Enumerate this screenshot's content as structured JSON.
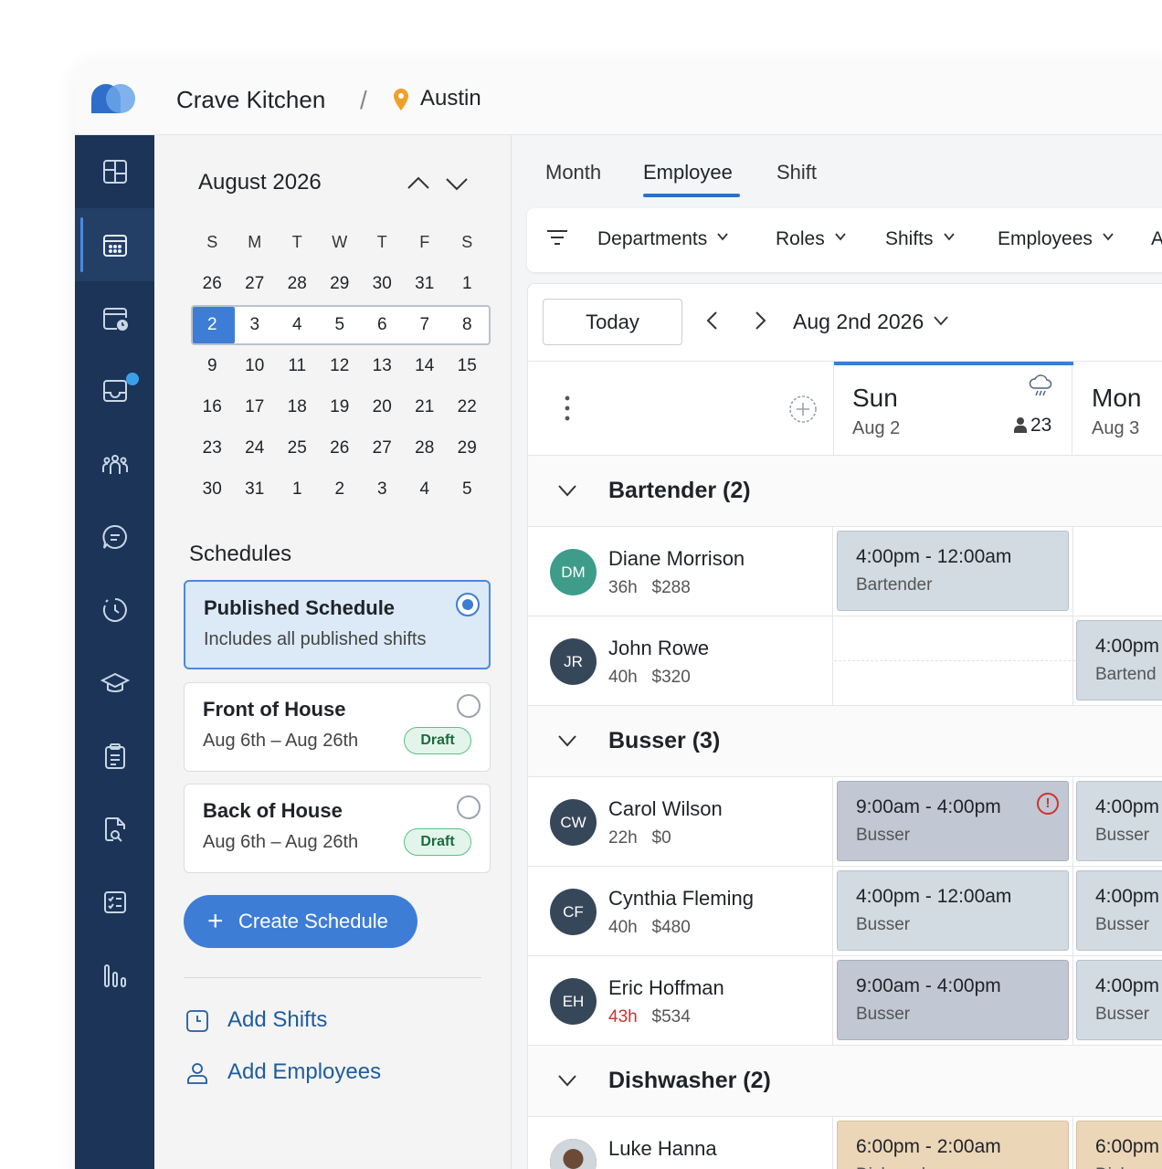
{
  "header": {
    "company": "Crave Kitchen",
    "separator": "/",
    "location": "Austin",
    "brand_color": "#2f6fc9"
  },
  "rail": {
    "items": [
      {
        "name": "dashboard-icon"
      },
      {
        "name": "schedule-calendar-icon",
        "active": true
      },
      {
        "name": "time-off-calendar-icon"
      },
      {
        "name": "inbox-icon",
        "notification": true
      },
      {
        "name": "team-icon"
      },
      {
        "name": "chat-icon"
      },
      {
        "name": "timeclock-icon"
      },
      {
        "name": "training-cap-icon"
      },
      {
        "name": "clipboard-icon"
      },
      {
        "name": "document-search-icon"
      },
      {
        "name": "checklist-icon"
      },
      {
        "name": "reports-bars-icon"
      }
    ]
  },
  "calendar": {
    "title": "August 2026",
    "weekdays": [
      "S",
      "M",
      "T",
      "W",
      "T",
      "F",
      "S"
    ],
    "weeks": [
      [
        "26",
        "27",
        "28",
        "29",
        "30",
        "31",
        "1"
      ],
      [
        "2",
        "3",
        "4",
        "5",
        "6",
        "7",
        "8"
      ],
      [
        "9",
        "10",
        "11",
        "12",
        "13",
        "14",
        "15"
      ],
      [
        "16",
        "17",
        "18",
        "19",
        "20",
        "21",
        "22"
      ],
      [
        "23",
        "24",
        "25",
        "26",
        "27",
        "28",
        "29"
      ],
      [
        "30",
        "31",
        "1",
        "2",
        "3",
        "4",
        "5"
      ]
    ],
    "selected_day": "2"
  },
  "schedules": {
    "title": "Schedules",
    "items": [
      {
        "title": "Published Schedule",
        "subtitle": "Includes all published shifts",
        "selected": true
      },
      {
        "title": "Front of House",
        "subtitle": "Aug 6th – Aug 26th",
        "badge": "Draft"
      },
      {
        "title": "Back of House",
        "subtitle": "Aug 6th – Aug 26th",
        "badge": "Draft"
      }
    ],
    "create_label": "Create Schedule",
    "create_icon": "+",
    "add_shifts": "Add Shifts",
    "add_employees": "Add Employees"
  },
  "tabs": [
    {
      "label": "Month"
    },
    {
      "label": "Employee",
      "active": true
    },
    {
      "label": "Shift"
    }
  ],
  "filters": [
    "Departments",
    "Roles",
    "Shifts",
    "Employees",
    "A"
  ],
  "toolbar": {
    "today": "Today",
    "date": "Aug 2nd 2026"
  },
  "days": [
    {
      "name": "Sun",
      "date": "Aug 2",
      "weather": "rain-cloud-icon",
      "count": "23",
      "active": true
    },
    {
      "name": "Mon",
      "date": "Aug 3"
    }
  ],
  "groups": [
    {
      "title": "Bartender (2)",
      "employees": [
        {
          "initials": "DM",
          "name": "Diane Morrison",
          "hours": "36h",
          "pay": "$288",
          "avatar_color": "#3d9d8a",
          "shifts": [
            {
              "day": 0,
              "time": "4:00pm - 12:00am",
              "role": "Bartender",
              "style": "a"
            }
          ]
        },
        {
          "initials": "JR",
          "name": "John Rowe",
          "hours": "40h",
          "pay": "$320",
          "avatar_color": "#37475a",
          "shifts": [
            {
              "day": 1,
              "time": "4:00pm",
              "role": "Bartend",
              "style": "a"
            }
          ]
        }
      ]
    },
    {
      "title": "Busser (3)",
      "employees": [
        {
          "initials": "CW",
          "name": "Carol Wilson",
          "hours": "22h",
          "pay": "$0",
          "avatar_color": "#37475a",
          "shifts": [
            {
              "day": 0,
              "time": "9:00am - 4:00pm",
              "role": "Busser",
              "style": "b",
              "warning": "!"
            },
            {
              "day": 1,
              "time": "4:00pm",
              "role": "Busser",
              "style": "a"
            }
          ]
        },
        {
          "initials": "CF",
          "name": "Cynthia Fleming",
          "hours": "40h",
          "pay": "$480",
          "avatar_color": "#37475a",
          "shifts": [
            {
              "day": 0,
              "time": "4:00pm - 12:00am",
              "role": "Busser",
              "style": "a"
            },
            {
              "day": 1,
              "time": "4:00pm",
              "role": "Busser",
              "style": "a"
            }
          ]
        },
        {
          "initials": "EH",
          "name": "Eric Hoffman",
          "hours": "43h",
          "pay": "$534",
          "overtime": true,
          "avatar_color": "#37475a",
          "shifts": [
            {
              "day": 0,
              "time": "9:00am - 4:00pm",
              "role": "Busser",
              "style": "b"
            },
            {
              "day": 1,
              "time": "4:00pm",
              "role": "Busser",
              "style": "a"
            }
          ]
        }
      ]
    },
    {
      "title": "Dishwasher (2)",
      "employees": [
        {
          "initials": "",
          "name": "Luke Hanna",
          "hours": "",
          "pay": "",
          "avatar_color": "#8a6a52",
          "photo": true,
          "shifts": [
            {
              "day": 0,
              "time": "6:00pm - 2:00am",
              "role": "Dishwasher",
              "style": "c"
            },
            {
              "day": 1,
              "time": "6:00pm",
              "role": "Dishwa",
              "style": "c"
            }
          ]
        }
      ]
    }
  ]
}
